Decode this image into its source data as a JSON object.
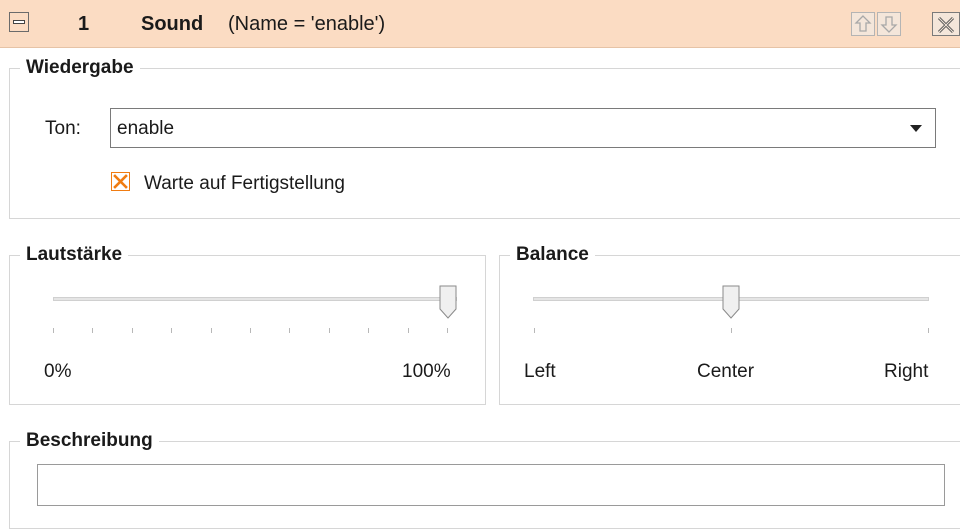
{
  "header": {
    "index": "1",
    "type": "Sound",
    "description": "(Name = 'enable')",
    "background": "#fbdcc3"
  },
  "playback": {
    "legend": "Wiedergabe",
    "tone_label": "Ton:",
    "tone_value": "enable",
    "wait_label": "Warte auf Fertigstellung",
    "wait_checked": true
  },
  "volume": {
    "legend": "Lautstärke",
    "min_label": "0%",
    "max_label": "100%",
    "value_percent": 100
  },
  "balance": {
    "legend": "Balance",
    "left_label": "Left",
    "center_label": "Center",
    "right_label": "Right",
    "value": 0
  },
  "description": {
    "legend": "Beschreibung",
    "value": ""
  },
  "icons": {
    "collapse": "minus-box-icon",
    "move_up": "arrow-up-icon",
    "move_down": "arrow-down-icon",
    "remove": "close-icon"
  },
  "colors": {
    "accent": "#f07c12",
    "header": "#fbdcc3"
  }
}
